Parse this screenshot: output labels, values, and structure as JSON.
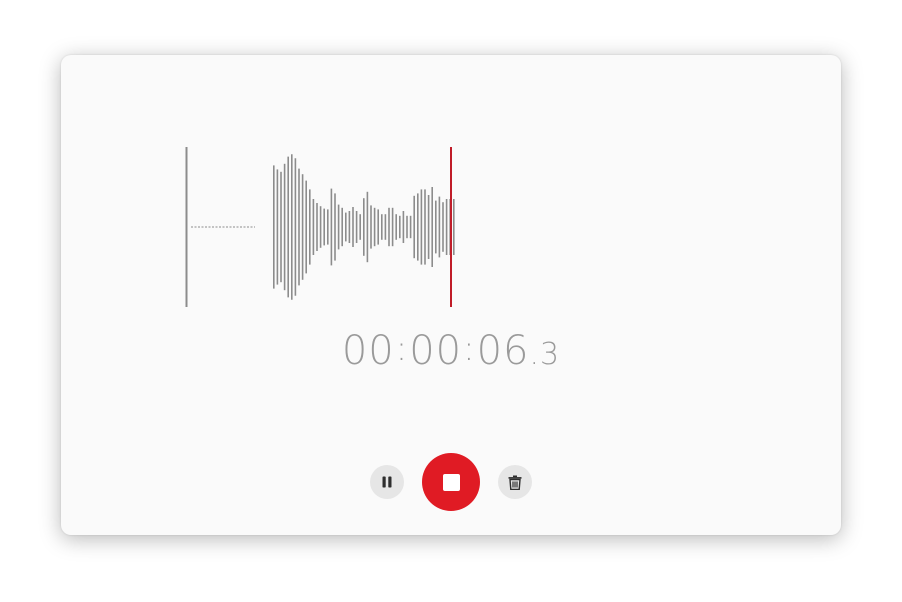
{
  "recorder": {
    "time_main": "00",
    "time_minutes": "00",
    "time_seconds": "06",
    "time_tenths": "3",
    "separator": ":",
    "decimal": "."
  },
  "controls": {
    "pause_icon": "pause-icon",
    "stop_icon": "stop-icon",
    "delete_icon": "trash-icon",
    "accent_color": "#e01b24"
  },
  "waveform": {
    "bar_color": "#8c8c8c",
    "playhead_color": "#c01c28",
    "levels": [
      0.02,
      0.02,
      0.02,
      0.02,
      0.02,
      0.02,
      0.02,
      0.02,
      0.02,
      0.02,
      0.02,
      0.02,
      0.02,
      0.02,
      0.02,
      0.02,
      0.02,
      0.02,
      0.02,
      0.02,
      0.02,
      0.02,
      0.02,
      0.77,
      0.72,
      0.69,
      0.79,
      0.88,
      0.91,
      0.86,
      0.73,
      0.66,
      0.58,
      0.47,
      0.35,
      0.3,
      0.26,
      0.23,
      0.22,
      0.48,
      0.42,
      0.28,
      0.24,
      0.18,
      0.2,
      0.25,
      0.2,
      0.16,
      0.36,
      0.44,
      0.27,
      0.24,
      0.22,
      0.16,
      0.16,
      0.24,
      0.24,
      0.16,
      0.14,
      0.2,
      0.14,
      0.14,
      0.39,
      0.42,
      0.47,
      0.47,
      0.4,
      0.5,
      0.33,
      0.38,
      0.31,
      0.35,
      0.35,
      0.35
    ]
  }
}
